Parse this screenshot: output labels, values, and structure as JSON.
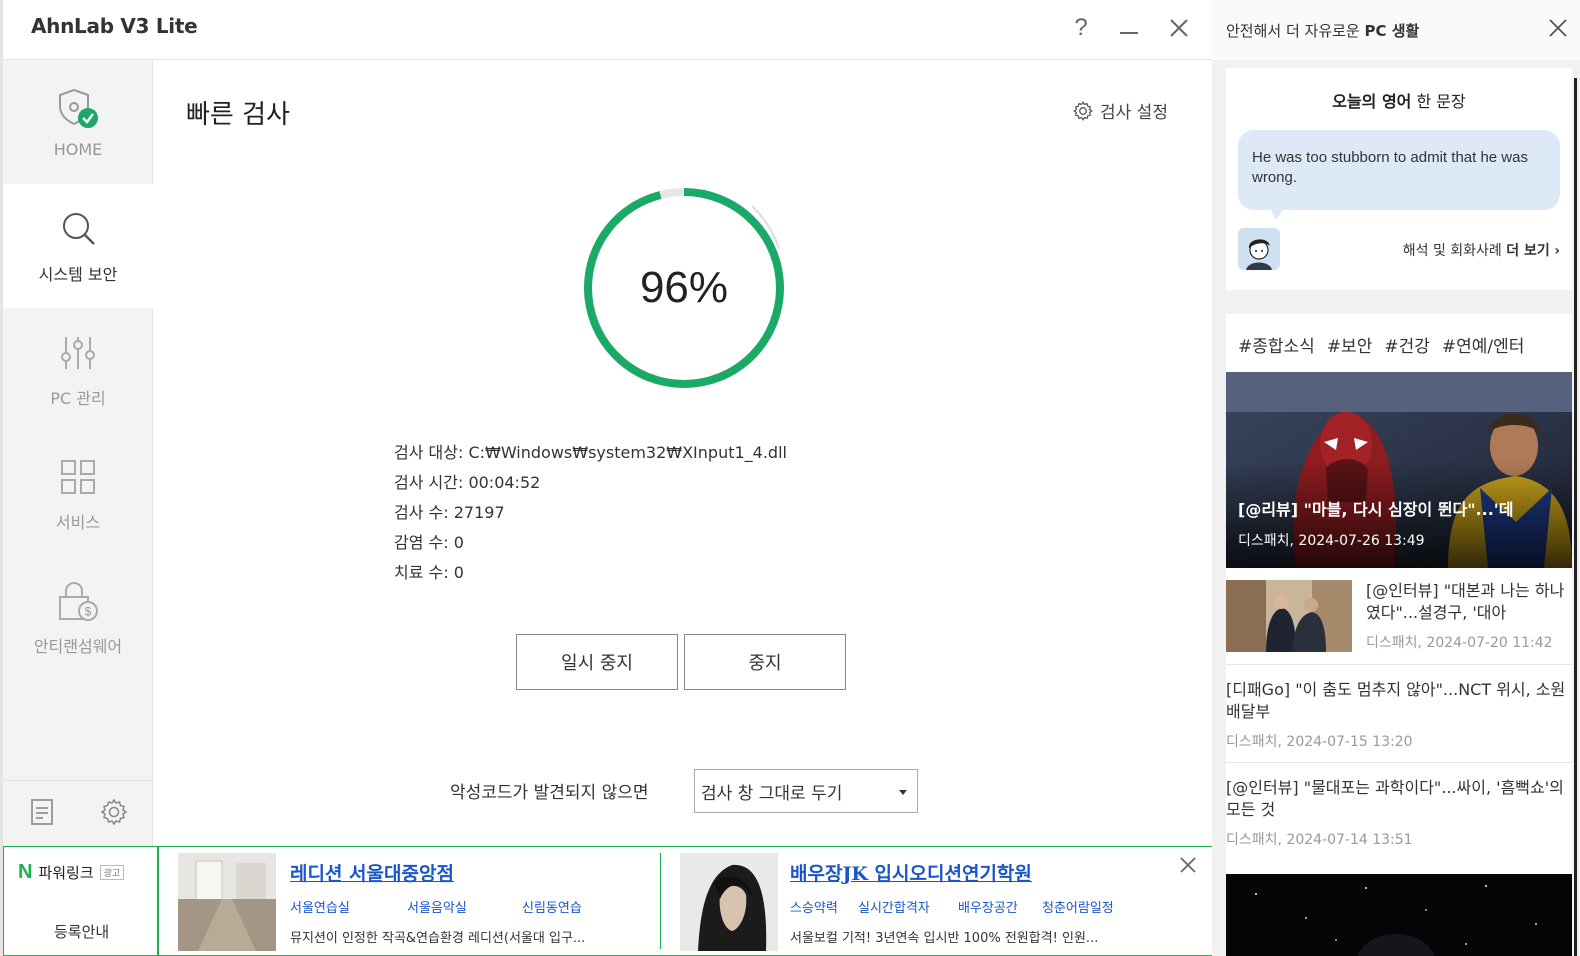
{
  "app": {
    "title": "AhnLab V3 Lite",
    "help_glyph": "?"
  },
  "nav": {
    "items": [
      {
        "id": "home",
        "label": "HOME",
        "icon": "shield-check-icon"
      },
      {
        "id": "system-security",
        "label": "시스템 보안",
        "icon": "search-icon"
      },
      {
        "id": "pc-management",
        "label": "PC 관리",
        "icon": "sliders-icon"
      },
      {
        "id": "services",
        "label": "서비스",
        "icon": "grid-icon"
      },
      {
        "id": "antiransomware",
        "label": "안티랜섬웨어",
        "icon": "lock-dollar-icon"
      }
    ],
    "active": "system-security"
  },
  "scan": {
    "title": "빠른 검사",
    "settings_label": "검사 설정",
    "progress_percent": 96,
    "progress_text": "96%",
    "target": "검사 대상: C:₩Windows₩system32₩XInput1_4.dll",
    "elapsed": "검사 시간: 00:04:52",
    "count": "검사 수: 27197",
    "infected": "감염 수: 0",
    "treated": "치료 수: 0",
    "pause_label": "일시 중지",
    "stop_label": "중지",
    "after_label": "악성코드가 발견되지 않으면",
    "after_value": "검사 창 그대로 두기"
  },
  "ads": {
    "powerlink_label": "파워링크",
    "powerlink_badge": "광고",
    "register_label": "등록안내",
    "items": [
      {
        "title": "레디션 서울대중앙점",
        "links": [
          "서울연습실",
          "서울음악실",
          "신림동연습"
        ],
        "desc": "뮤지션이 인정한 작곡&연습환경 레디션(서울대 입구..."
      },
      {
        "title": "배우장JK 입시오디션연기학원",
        "links": [
          "스승약력",
          "실시간합격자",
          "배우장공간",
          "청춘어람일정"
        ],
        "desc": "서울보컬 기적! 3년연속 입시반 100% 전원합격! 인원..."
      }
    ]
  },
  "panel": {
    "header_prefix": "안전해서 더 자유로운 ",
    "header_bold": "PC 생활",
    "english": {
      "title_bold": "오늘의 영어",
      "title_rest": " 한 문장",
      "sentence": "He was too stubborn to admit that he was wrong.",
      "more_prefix": "해석 및 회화사례 ",
      "more_bold": "더 보기",
      "more_arrow": "›"
    },
    "tags": [
      "#종합소식",
      "#보안",
      "#건강",
      "#연예/엔터"
    ],
    "news": [
      {
        "title": "[@리뷰] \"마블, 다시 심장이 뛴다\"...'데",
        "meta": "디스패치, 2024-07-26 13:49"
      },
      {
        "title": "[@인터뷰] \"대본과 나는 하나였다\"...설경구, '대아",
        "meta": "디스패치, 2024-07-20 11:42"
      },
      {
        "title": "[디패Go] \"이 춤도 멈추지 않아\"...NCT 위시, 소원 배달부",
        "meta": "디스패치, 2024-07-15 13:20"
      },
      {
        "title": "[@인터뷰] \"물대포는 과학이다\"...싸이, '흠뻑쇼'의 모든 것",
        "meta": "디스패치, 2024-07-14 13:51"
      }
    ]
  },
  "colors": {
    "accent": "#1aa967",
    "ad_border": "#19b34f",
    "ad_link": "#1a55c9",
    "bubble": "#dde9f6"
  }
}
